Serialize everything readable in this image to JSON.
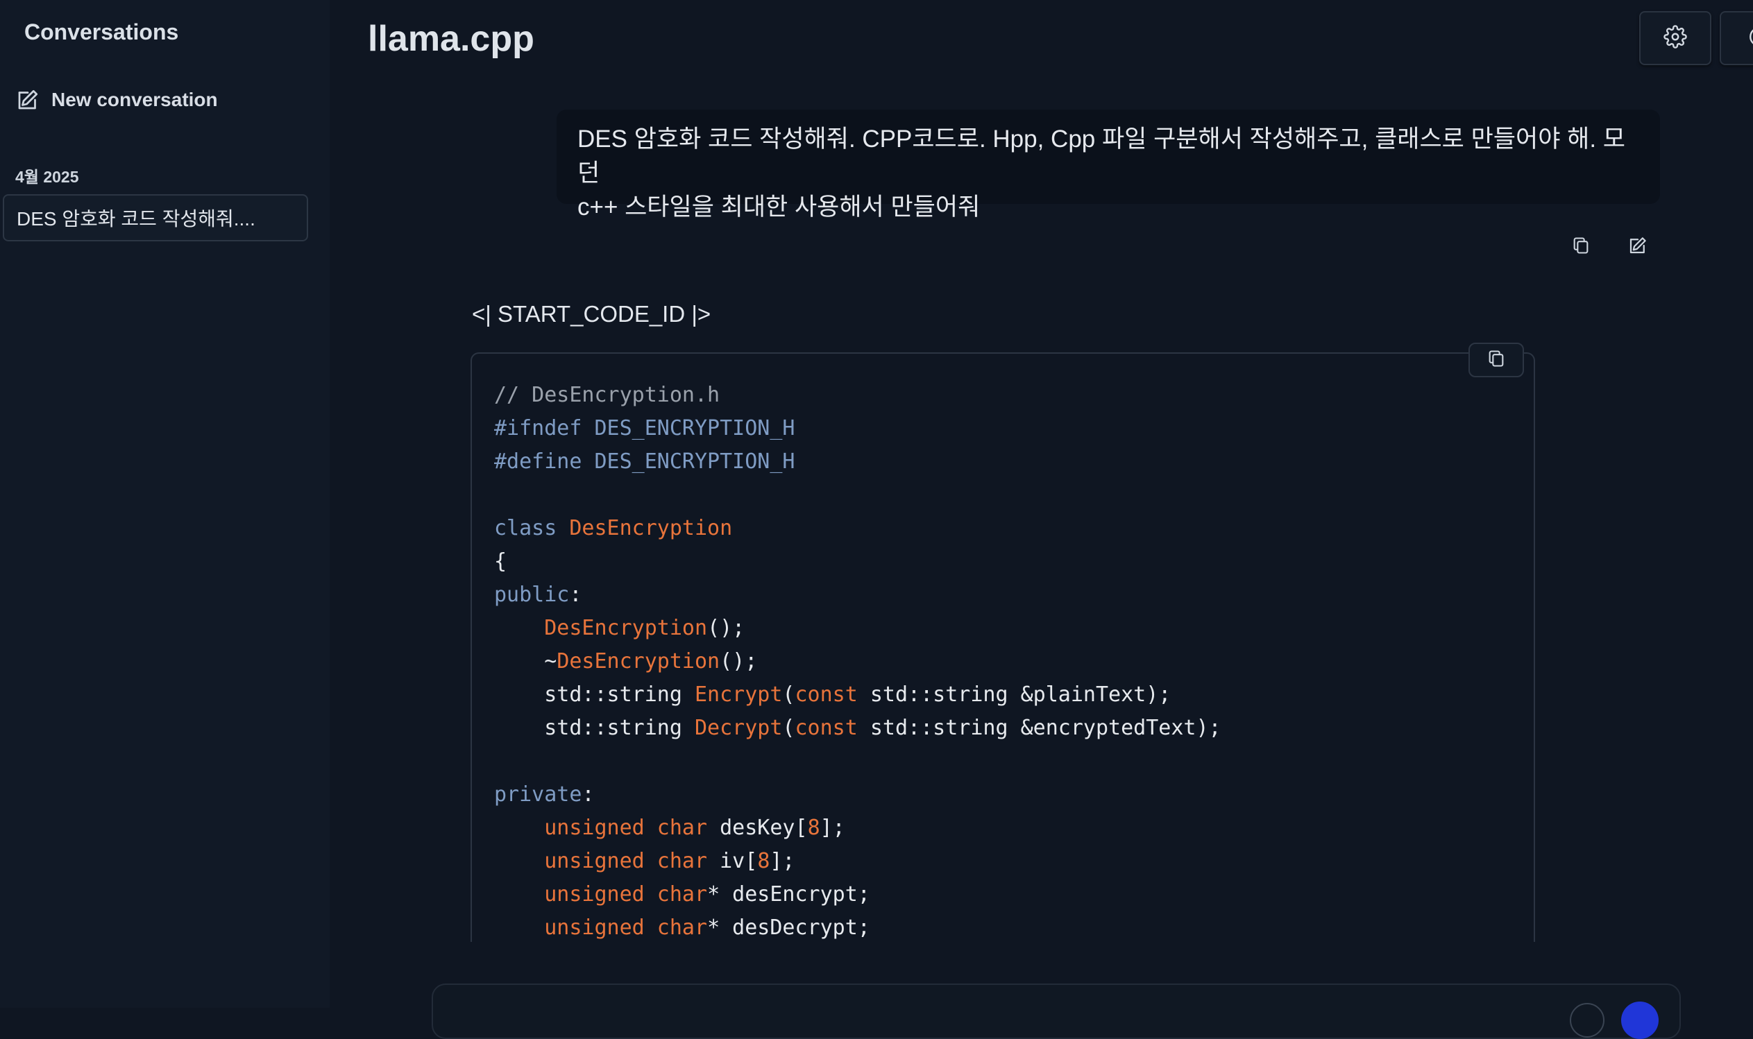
{
  "sidebar": {
    "title": "Conversations",
    "new_conversation": "New conversation",
    "section_label": "4월 2025",
    "items": [
      {
        "label": "DES 암호화 코드 작성해줘...."
      }
    ]
  },
  "header": {
    "app_title": "llama.cpp",
    "settings_icon": "gear-icon",
    "theme_icon": "theme-icon"
  },
  "chat": {
    "user_message_line1": "DES 암호화 코드 작성해줘. CPP코드로. Hpp, Cpp 파일 구분해서 작성해주고, 클래스로 만들어야 해. 모던",
    "user_message_line2": "c++ 스타일을 최대한 사용해서 만들어줘",
    "assistant_intro": "<| START_CODE_ID |>",
    "code": {
      "language": "cpp",
      "lines": [
        [
          {
            "t": "// DesEncryption.h",
            "c": "comment"
          }
        ],
        [
          {
            "t": "#ifndef DES_ENCRYPTION_H",
            "c": "pre"
          }
        ],
        [
          {
            "t": "#define DES_ENCRYPTION_H",
            "c": "pre"
          }
        ],
        [],
        [
          {
            "t": "class ",
            "c": "kw"
          },
          {
            "t": "DesEncryption",
            "c": "type"
          }
        ],
        [
          {
            "t": "{",
            "c": ""
          }
        ],
        [
          {
            "t": "public",
            "c": "kw"
          },
          {
            "t": ":",
            "c": ""
          }
        ],
        [
          {
            "t": "    ",
            "c": ""
          },
          {
            "t": "DesEncryption",
            "c": "fn"
          },
          {
            "t": "();",
            "c": ""
          }
        ],
        [
          {
            "t": "    ~",
            "c": ""
          },
          {
            "t": "DesEncryption",
            "c": "fn"
          },
          {
            "t": "();",
            "c": ""
          }
        ],
        [
          {
            "t": "    std::string ",
            "c": ""
          },
          {
            "t": "Encrypt",
            "c": "fn"
          },
          {
            "t": "(",
            "c": ""
          },
          {
            "t": "const",
            "c": "type"
          },
          {
            "t": " std::string &plainText);",
            "c": ""
          }
        ],
        [
          {
            "t": "    std::string ",
            "c": ""
          },
          {
            "t": "Decrypt",
            "c": "fn"
          },
          {
            "t": "(",
            "c": ""
          },
          {
            "t": "const",
            "c": "type"
          },
          {
            "t": " std::string &encryptedText);",
            "c": ""
          }
        ],
        [],
        [
          {
            "t": "private",
            "c": "kw"
          },
          {
            "t": ":",
            "c": ""
          }
        ],
        [
          {
            "t": "    ",
            "c": ""
          },
          {
            "t": "unsigned char",
            "c": "type"
          },
          {
            "t": " desKey[",
            "c": ""
          },
          {
            "t": "8",
            "c": "num"
          },
          {
            "t": "];",
            "c": ""
          }
        ],
        [
          {
            "t": "    ",
            "c": ""
          },
          {
            "t": "unsigned char",
            "c": "type"
          },
          {
            "t": " iv[",
            "c": ""
          },
          {
            "t": "8",
            "c": "num"
          },
          {
            "t": "];",
            "c": ""
          }
        ],
        [
          {
            "t": "    ",
            "c": ""
          },
          {
            "t": "unsigned char",
            "c": "type"
          },
          {
            "t": "* desEncrypt;",
            "c": ""
          }
        ],
        [
          {
            "t": "    ",
            "c": ""
          },
          {
            "t": "unsigned char",
            "c": "type"
          },
          {
            "t": "* desDecrypt;",
            "c": ""
          }
        ]
      ]
    }
  },
  "colors": {
    "background": "#0f1622",
    "sidebar": "#111926",
    "send_button": "#2036d8",
    "code_keyword": "#7f9cc4",
    "code_type": "#e8743b",
    "code_comment": "#9aa1ab"
  }
}
